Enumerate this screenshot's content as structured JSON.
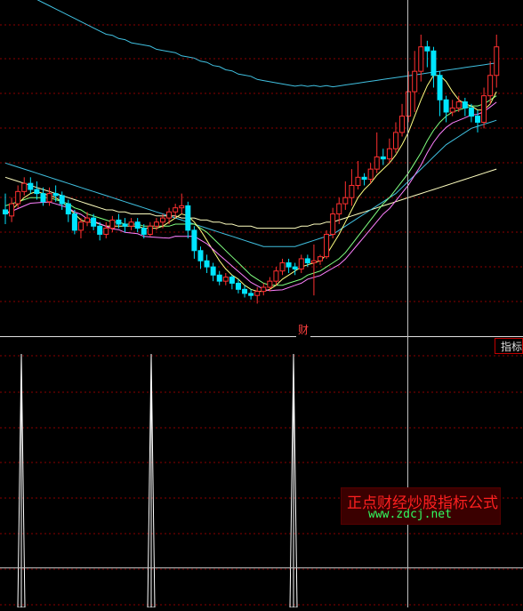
{
  "price_panel_label": "财",
  "indicator_tab_label": "指标",
  "watermark": {
    "title": "正点财经炒股指标公式",
    "url": "www.zdcj.net"
  },
  "colors": {
    "up": "#ff3030",
    "down": "#00e5ff",
    "grid": "#8b0000",
    "crosshair": "#c0c0c0",
    "ma_yellow": "#ffff80",
    "ma_white": "#f0f0f0",
    "ma_pink": "#ff80ff",
    "ma_green": "#80ff80",
    "ma_cyan": "#40c0e0",
    "ma_cream": "#ffffc0"
  },
  "chart_data": [
    {
      "type": "candlestick",
      "title": "",
      "series_names": [],
      "candles": [
        [
          72,
          70,
          80,
          65
        ],
        [
          69,
          75,
          78,
          66
        ],
        [
          75,
          81,
          84,
          73
        ],
        [
          81,
          85,
          88,
          79
        ],
        [
          85,
          82,
          88,
          80
        ],
        [
          82,
          80,
          86,
          77
        ],
        [
          80,
          76,
          83,
          74
        ],
        [
          76,
          80,
          83,
          74
        ],
        [
          80,
          79,
          84,
          76
        ],
        [
          79,
          75,
          81,
          72
        ],
        [
          75,
          70,
          77,
          66
        ],
        [
          70,
          62,
          72,
          60
        ],
        [
          62,
          66,
          68,
          58
        ],
        [
          66,
          68,
          71,
          64
        ],
        [
          68,
          64,
          70,
          62
        ],
        [
          64,
          60,
          66,
          57
        ],
        [
          60,
          63,
          66,
          58
        ],
        [
          63,
          67,
          69,
          61
        ],
        [
          67,
          65,
          70,
          63
        ],
        [
          65,
          64,
          68,
          61
        ],
        [
          64,
          66,
          68,
          62
        ],
        [
          66,
          63,
          68,
          61
        ],
        [
          63,
          60,
          65,
          58
        ],
        [
          60,
          64,
          66,
          59
        ],
        [
          64,
          66,
          68,
          62
        ],
        [
          66,
          68,
          70,
          63
        ],
        [
          68,
          71,
          73,
          65
        ],
        [
          71,
          73,
          75,
          68
        ],
        [
          73,
          74,
          80,
          70
        ],
        [
          74,
          62,
          76,
          58
        ],
        [
          62,
          52,
          64,
          48
        ],
        [
          52,
          47,
          54,
          43
        ],
        [
          47,
          44,
          50,
          41
        ],
        [
          44,
          40,
          46,
          37
        ],
        [
          40,
          37,
          42,
          35
        ],
        [
          37,
          39,
          41,
          35
        ],
        [
          39,
          36,
          40,
          33
        ],
        [
          36,
          33,
          38,
          31
        ],
        [
          33,
          31,
          35,
          29
        ],
        [
          31,
          30,
          33,
          28
        ],
        [
          30,
          32,
          34,
          26
        ],
        [
          32,
          34,
          36,
          30
        ],
        [
          34,
          37,
          39,
          32
        ],
        [
          37,
          42,
          44,
          35
        ],
        [
          42,
          46,
          48,
          40
        ],
        [
          46,
          44,
          48,
          41
        ],
        [
          44,
          43,
          46,
          40
        ],
        [
          43,
          48,
          50,
          41
        ],
        [
          48,
          46,
          50,
          44
        ],
        [
          46,
          47,
          55,
          30
        ],
        [
          47,
          49,
          50,
          45
        ],
        [
          49,
          60,
          62,
          48
        ],
        [
          60,
          70,
          73,
          58
        ],
        [
          70,
          75,
          78,
          65
        ],
        [
          75,
          78,
          86,
          72
        ],
        [
          78,
          84,
          92,
          74
        ],
        [
          84,
          88,
          96,
          82
        ],
        [
          88,
          87,
          90,
          84
        ],
        [
          87,
          92,
          95,
          85
        ],
        [
          92,
          98,
          110,
          90
        ],
        [
          98,
          97,
          102,
          94
        ],
        [
          97,
          102,
          107,
          95
        ],
        [
          102,
          110,
          115,
          100
        ],
        [
          110,
          118,
          124,
          108
        ],
        [
          118,
          130,
          140,
          115
        ],
        [
          130,
          140,
          150,
          120
        ],
        [
          140,
          152,
          158,
          135
        ],
        [
          152,
          150,
          155,
          142
        ],
        [
          150,
          138,
          152,
          132
        ],
        [
          138,
          126,
          140,
          118
        ],
        [
          126,
          120,
          128,
          115
        ],
        [
          120,
          122,
          126,
          118
        ],
        [
          122,
          125,
          128,
          120
        ],
        [
          125,
          122,
          127,
          118
        ],
        [
          122,
          118,
          124,
          115
        ],
        [
          118,
          115,
          121,
          110
        ],
        [
          115,
          128,
          132,
          112
        ],
        [
          128,
          138,
          145,
          124
        ],
        [
          138,
          152,
          158,
          132
        ]
      ],
      "ma_short": [
        70,
        72,
        75,
        78,
        80,
        81,
        80,
        79,
        78,
        76,
        73,
        70,
        67,
        66,
        66,
        65,
        64,
        64,
        64,
        64,
        64,
        64,
        63,
        63,
        63,
        64,
        66,
        68,
        70,
        69,
        66,
        62,
        57,
        52,
        47,
        43,
        40,
        38,
        35,
        33,
        32,
        32,
        33,
        35,
        38,
        40,
        42,
        44,
        45,
        46,
        47,
        50,
        55,
        60,
        66,
        72,
        78,
        82,
        85,
        89,
        92,
        95,
        99,
        104,
        110,
        118,
        126,
        133,
        138,
        138,
        135,
        130,
        126,
        124,
        123,
        121,
        121,
        124,
        130
      ],
      "ma_mid": [
        74,
        75,
        76,
        77,
        78,
        78,
        78,
        78,
        77,
        76,
        75,
        73,
        72,
        70,
        69,
        68,
        67,
        66,
        66,
        65,
        65,
        65,
        64,
        64,
        64,
        64,
        64,
        65,
        65,
        65,
        65,
        63,
        61,
        58,
        55,
        52,
        49,
        46,
        43,
        40,
        38,
        36,
        35,
        35,
        35,
        36,
        37,
        38,
        40,
        41,
        42,
        44,
        46,
        48,
        51,
        55,
        59,
        63,
        67,
        71,
        75,
        78,
        82,
        86,
        90,
        95,
        100,
        106,
        111,
        115,
        118,
        120,
        121,
        122,
        123,
        123,
        124,
        126,
        128
      ],
      "ma_long": [
        95,
        94,
        93,
        92,
        91,
        90,
        89,
        88,
        87,
        86,
        85,
        84,
        83,
        82,
        81,
        80,
        79,
        78,
        77,
        76,
        75,
        74,
        73,
        72,
        71,
        70,
        69,
        68,
        67,
        66,
        65,
        64,
        63,
        62,
        61,
        60,
        59,
        58,
        57,
        56,
        55,
        54,
        54,
        54,
        54,
        54,
        54,
        55,
        56,
        57,
        58,
        59,
        60,
        62,
        64,
        66,
        68,
        70,
        72,
        74,
        76,
        78,
        80,
        83,
        86,
        89,
        92,
        95,
        98,
        101,
        104,
        106,
        108,
        110,
        112,
        113,
        114,
        115,
        116
      ],
      "ma_longer": [
        88,
        87,
        86,
        85,
        84,
        83,
        82,
        81,
        80,
        79,
        78,
        77,
        76,
        75,
        74,
        73,
        72,
        72,
        71,
        71,
        70,
        70,
        70,
        70,
        69,
        69,
        69,
        69,
        68,
        68,
        68,
        67,
        67,
        66,
        66,
        65,
        65,
        64,
        64,
        64,
        63,
        63,
        63,
        63,
        63,
        63,
        63,
        64,
        64,
        65,
        65,
        66,
        66,
        67,
        68,
        69,
        70,
        71,
        72,
        73,
        74,
        75,
        76,
        77,
        78,
        79,
        80,
        81,
        82,
        83,
        84,
        85,
        86,
        87,
        88,
        89,
        90,
        91,
        92
      ]
    },
    {
      "type": "area",
      "title": "",
      "spikes": [
        {
          "x": 24,
          "value": 1.0
        },
        {
          "x": 170,
          "value": 1.0
        },
        {
          "x": 330,
          "value": 1.0
        }
      ],
      "ylim": [
        0,
        1
      ]
    }
  ]
}
